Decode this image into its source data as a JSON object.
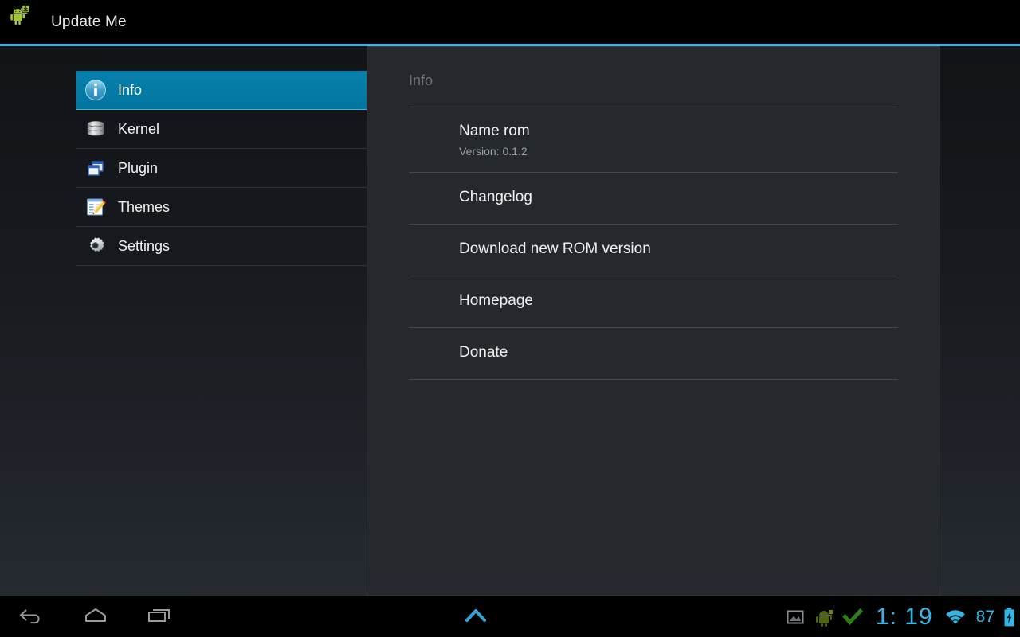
{
  "app": {
    "title": "Update Me",
    "icon": "android-download-icon",
    "accent_color": "#33b5e5"
  },
  "sidebar": {
    "items": [
      {
        "label": "Info",
        "icon": "info-circle-icon",
        "selected": true
      },
      {
        "label": "Kernel",
        "icon": "database-icon",
        "selected": false
      },
      {
        "label": "Plugin",
        "icon": "windows-stack-icon",
        "selected": false
      },
      {
        "label": "Themes",
        "icon": "notepad-pencil-icon",
        "selected": false
      },
      {
        "label": "Settings",
        "icon": "gear-icon",
        "selected": false
      }
    ],
    "selected_color": "#0781ab"
  },
  "panel": {
    "title": "Info",
    "rows": [
      {
        "title": "Name rom",
        "sub": "Version: 0.1.2"
      },
      {
        "title": "Changelog",
        "sub": ""
      },
      {
        "title": "Download new ROM version",
        "sub": ""
      },
      {
        "title": "Homepage",
        "sub": ""
      },
      {
        "title": "Donate",
        "sub": ""
      }
    ]
  },
  "systembar": {
    "nav": [
      {
        "name": "back",
        "icon": "back-arrow-icon"
      },
      {
        "name": "home",
        "icon": "home-pentagon-icon"
      },
      {
        "name": "recents",
        "icon": "recent-apps-icon"
      }
    ],
    "drawer_handle_icon": "chevron-up-icon",
    "notifications": [
      {
        "icon": "screenshot-image-icon"
      },
      {
        "icon": "android-robot-icon"
      },
      {
        "icon": "green-check-icon"
      }
    ],
    "clock": "1: 19",
    "wifi_icon": "wifi-icon",
    "battery_percent": "87",
    "battery_icon": "battery-charging-icon",
    "text_color": "#33b5e5"
  }
}
